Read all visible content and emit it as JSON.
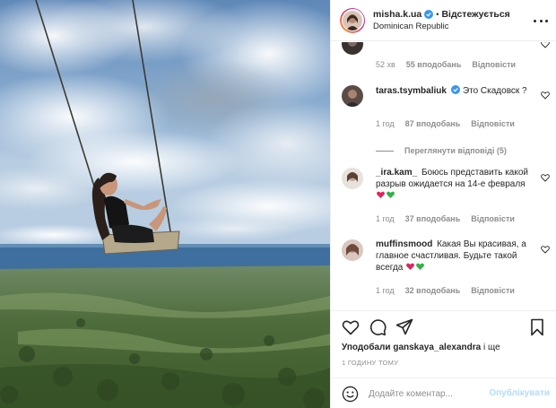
{
  "header": {
    "username": "misha.k.ua",
    "separator": "•",
    "follow_label": "Відстежується",
    "location": "Dominican Republic"
  },
  "comments": [
    {
      "username": "",
      "text": "",
      "time": "52 хв",
      "likes": "55 вподобань",
      "reply": "Відповісти"
    },
    {
      "username": "taras.tsymbaliuk",
      "text": "Это Скадовск ?",
      "time": "1 год",
      "likes": "87 вподобань",
      "reply": "Відповісти"
    },
    {
      "username": "_ira.kam_",
      "text": "Боюсь представить какой разрыв ожидается на 14-е февраля",
      "time": "1 год",
      "likes": "37 вподобань",
      "reply": "Відповісти"
    },
    {
      "username": "muffinsmood",
      "text": "Какая Вы красивая, а главное счастливая. Будьте такой всегда",
      "time": "1 год",
      "likes": "32 вподобань",
      "reply": "Відповісти"
    }
  ],
  "view_replies": "Переглянути відповіді (5)",
  "liked_by": {
    "prefix": "Уподобали",
    "user": "ganskaya_alexandra",
    "suffix": "і ще"
  },
  "post_time": "1 ГОДИНУ ТОМУ",
  "composer": {
    "placeholder": "Додайте коментар...",
    "post_label": "Опублікувати"
  },
  "icons": [
    "verified-icon",
    "more-icon",
    "heart-icon",
    "comment-icon",
    "share-icon",
    "bookmark-icon",
    "emoji-icon"
  ],
  "colors": {
    "accent_disabled": "#b3dbff",
    "verified": "#3897f0",
    "heart_red": "#e0245e",
    "heart_green": "#2fb344",
    "muted": "#8e8e8e"
  }
}
